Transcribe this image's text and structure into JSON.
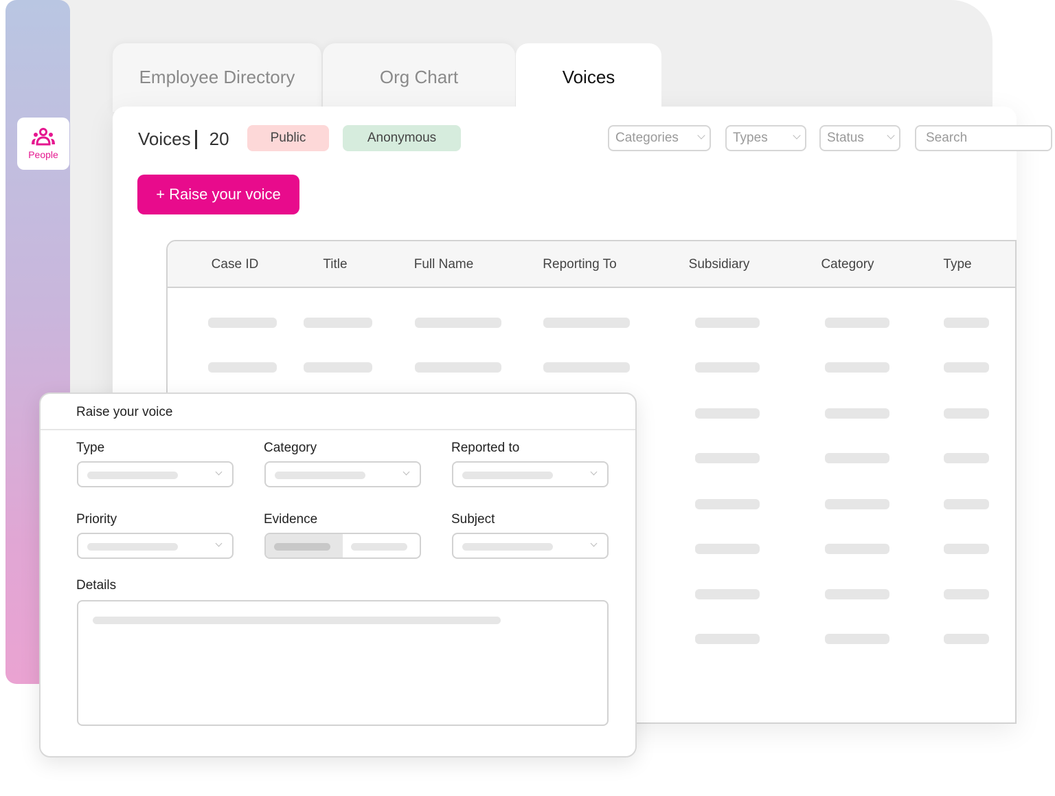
{
  "sidebar": {
    "items": [
      {
        "label": "People",
        "icon": "people-icon",
        "active": true
      }
    ],
    "accent_color": "#e5178f"
  },
  "tabs": [
    {
      "label": "Employee Directory",
      "active": false
    },
    {
      "label": "Org Chart",
      "active": false
    },
    {
      "label": "Voices",
      "active": true
    }
  ],
  "header": {
    "title": "Voices",
    "count": "20",
    "pills": [
      {
        "label": "Public",
        "color": "#fdd8d8"
      },
      {
        "label": "Anonymous",
        "color": "#d6ecdd"
      }
    ],
    "filters": [
      {
        "label": "Categories"
      },
      {
        "label": "Types"
      },
      {
        "label": "Status"
      }
    ],
    "search": {
      "placeholder": "Search",
      "value": ""
    }
  },
  "actions": {
    "raise_voice_label": "+ Raise your voice",
    "raise_voice_color": "#e80b8c"
  },
  "table": {
    "columns": [
      "Case ID",
      "Title",
      "Full Name",
      "Reporting To",
      "Subsidiary",
      "Category",
      "Type"
    ],
    "rows_loading": 8
  },
  "modal": {
    "title": "Raise your voice",
    "fields": {
      "type": "Type",
      "category": "Category",
      "reported_to": "Reported to",
      "priority": "Priority",
      "evidence": "Evidence",
      "subject": "Subject",
      "details": "Details"
    }
  }
}
